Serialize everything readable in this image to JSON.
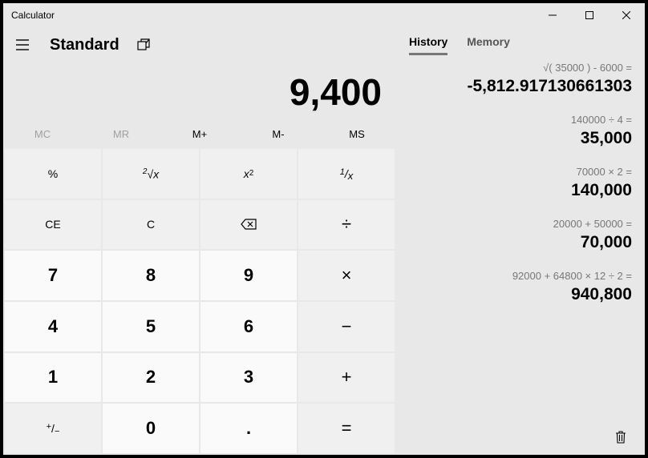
{
  "window": {
    "title": "Calculator"
  },
  "mode": {
    "name": "Standard"
  },
  "display": {
    "value": "9,400"
  },
  "memory_row": {
    "mc": "MC",
    "mr": "MR",
    "mplus": "M+",
    "mminus": "M-",
    "ms": "MS"
  },
  "keys": {
    "percent": "%",
    "root": "²√x",
    "square": "x²",
    "reciprocal": "¹/ₓ",
    "ce": "CE",
    "c": "C",
    "backspace": "⌫",
    "divide": "÷",
    "k7": "7",
    "k8": "8",
    "k9": "9",
    "multiply": "×",
    "k4": "4",
    "k5": "5",
    "k6": "6",
    "minus": "−",
    "k1": "1",
    "k2": "2",
    "k3": "3",
    "plus": "+",
    "negate": "⁺/₋",
    "k0": "0",
    "decimal": ".",
    "equals": "="
  },
  "tabs": {
    "history": "History",
    "memory": "Memory"
  },
  "history": [
    {
      "expr": "√( 35000 )   -   6000 =",
      "result": "-5,812.917130661303"
    },
    {
      "expr": "140000   ÷   4 =",
      "result": "35,000"
    },
    {
      "expr": "70000   ×   2 =",
      "result": "140,000"
    },
    {
      "expr": "20000   +   50000 =",
      "result": "70,000"
    },
    {
      "expr": "92000   +   64800   ×   12   ÷   2 =",
      "result": "940,800"
    }
  ]
}
